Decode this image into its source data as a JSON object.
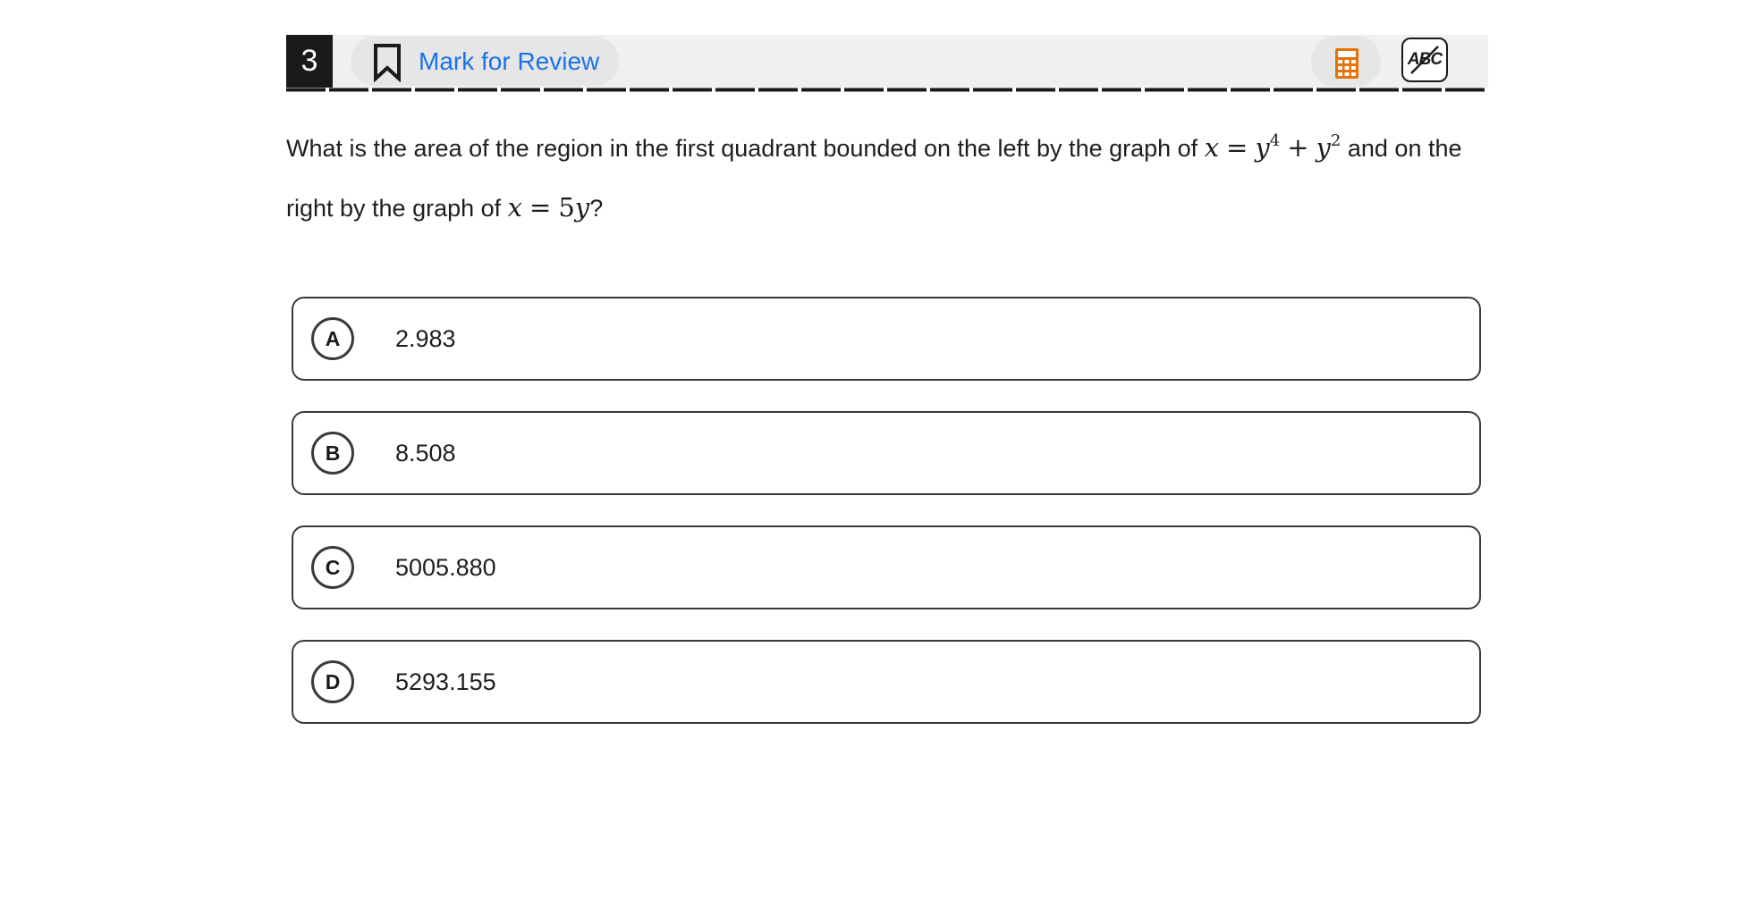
{
  "header": {
    "question_number": "3",
    "mark_for_review_label": "Mark for Review",
    "accent_color": "#1a73e8",
    "calculator_icon": "calculator-icon",
    "calculator_color": "#e8710a",
    "eliminator_label": "ABC"
  },
  "question": {
    "text_part1": "What is the area of the region in the first quadrant bounded on the left by the graph of",
    "math1": {
      "lhs": "x",
      "eq": "=",
      "term1_base": "y",
      "term1_exp": "4",
      "plus": "+",
      "term2_base": "y",
      "term2_exp": "2"
    },
    "text_part2": "and on the right by the graph of",
    "math2": {
      "lhs": "x",
      "eq": "=",
      "coef": "5",
      "var": "y"
    },
    "text_part3": "?"
  },
  "options": [
    {
      "letter": "A",
      "text": "2.983"
    },
    {
      "letter": "B",
      "text": "8.508"
    },
    {
      "letter": "C",
      "text": "5005.880"
    },
    {
      "letter": "D",
      "text": "5293.155"
    }
  ]
}
